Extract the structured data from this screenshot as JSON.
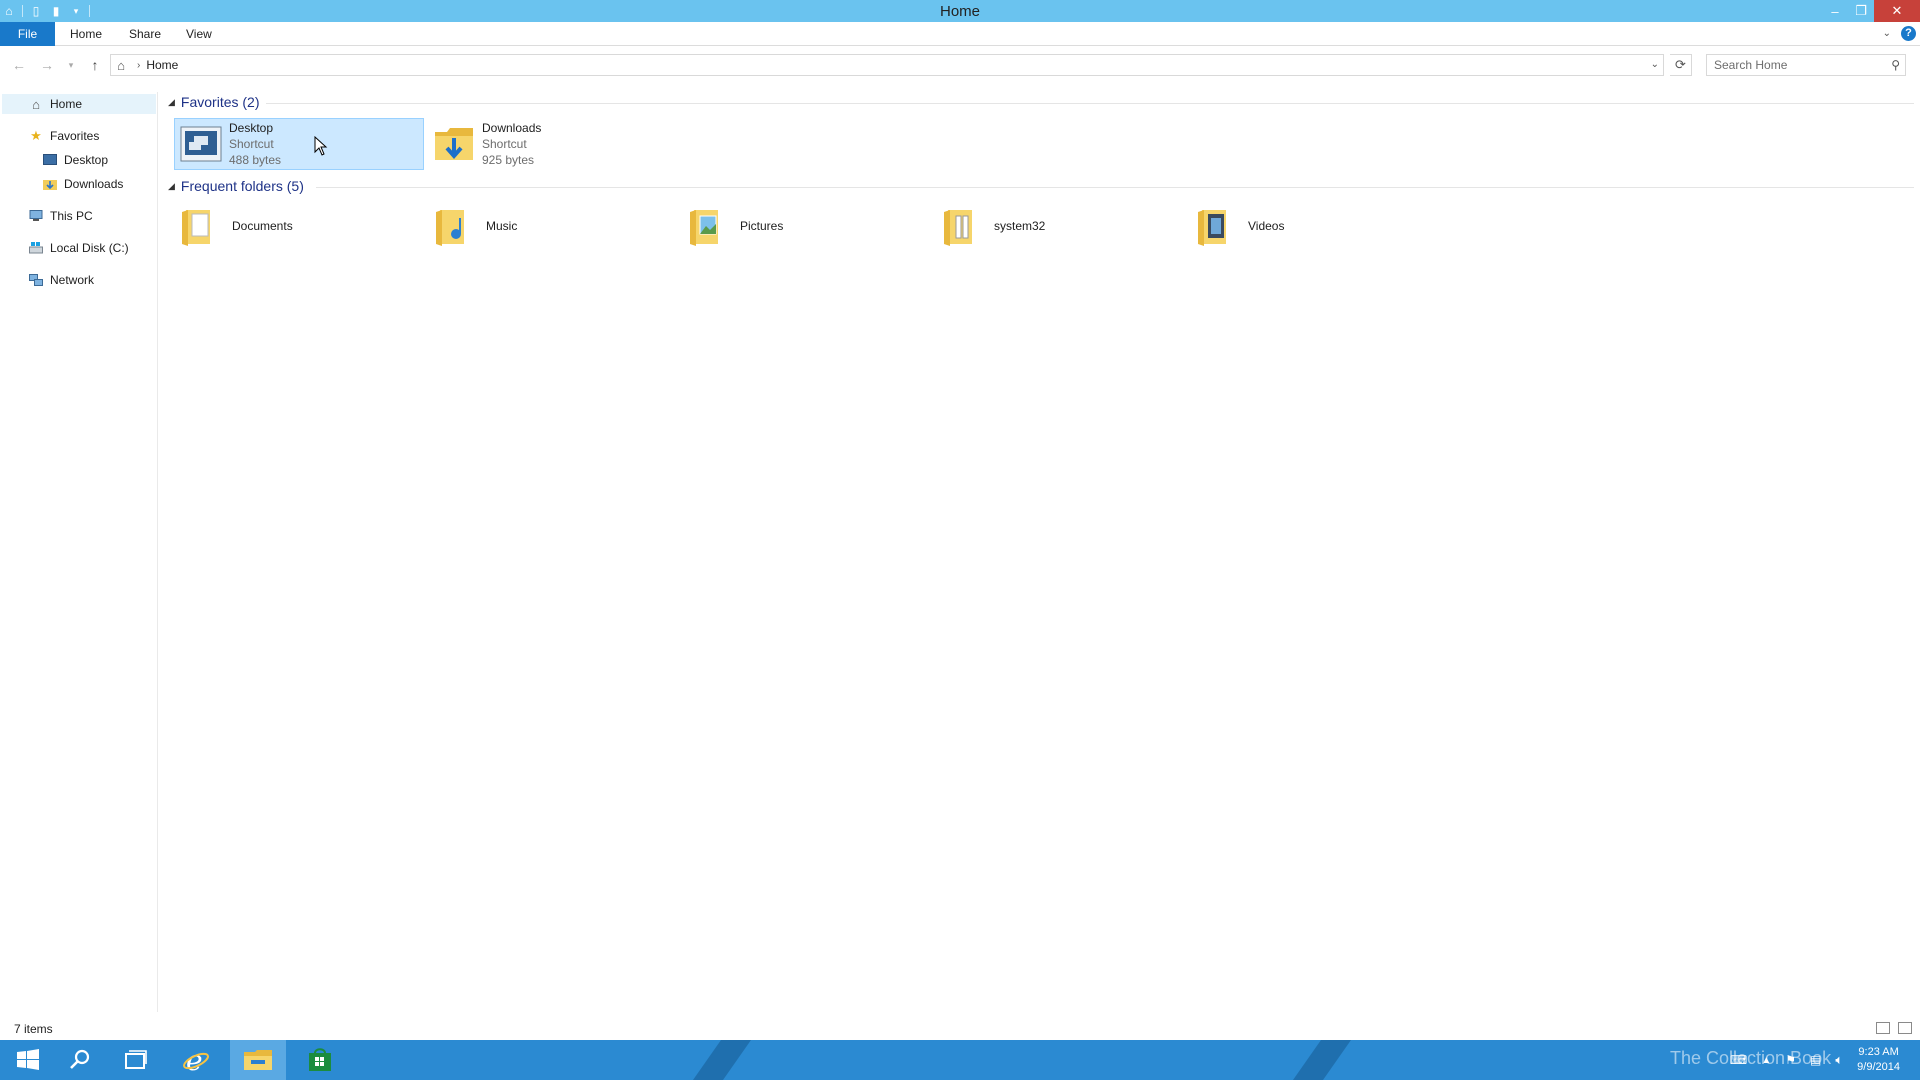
{
  "window": {
    "title": "Home"
  },
  "ribbon": {
    "tabs": [
      "File",
      "Home",
      "Share",
      "View"
    ]
  },
  "address": {
    "crumb": "Home",
    "search_placeholder": "Search Home"
  },
  "nav": {
    "home": "Home",
    "favorites": "Favorites",
    "desktop": "Desktop",
    "downloads": "Downloads",
    "this_pc": "This PC",
    "local_disk": "Local Disk (C:)",
    "network": "Network"
  },
  "favorites": {
    "header": "Favorites (2)",
    "items": [
      {
        "name": "Desktop",
        "type": "Shortcut",
        "size": "488 bytes",
        "icon": "desktop-icon"
      },
      {
        "name": "Downloads",
        "type": "Shortcut",
        "size": "925 bytes",
        "icon": "downloads-folder-icon"
      }
    ]
  },
  "frequent": {
    "header": "Frequent folders (5)",
    "items": [
      {
        "name": "Documents",
        "icon": "documents-folder-icon"
      },
      {
        "name": "Music",
        "icon": "music-folder-icon"
      },
      {
        "name": "Pictures",
        "icon": "pictures-folder-icon"
      },
      {
        "name": "system32",
        "icon": "system32-folder-icon"
      },
      {
        "name": "Videos",
        "icon": "videos-folder-icon"
      }
    ]
  },
  "status": {
    "count": "7 items"
  },
  "taskbar": {
    "time": "9:23 AM",
    "date": "9/9/2014",
    "watermark": "The Collection Book"
  },
  "colors": {
    "titlebar": "#6ac3ef",
    "accent": "#1979ca",
    "taskbar": "#2b8ad2",
    "selection": "#cce8ff"
  }
}
